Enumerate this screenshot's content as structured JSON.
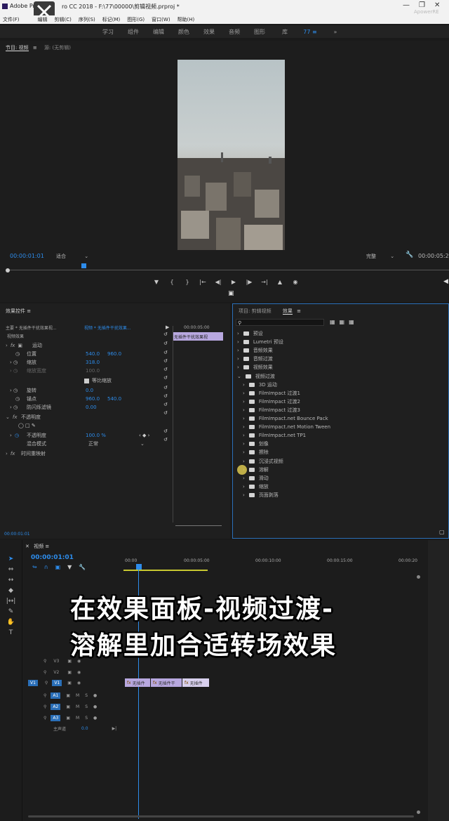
{
  "window": {
    "title": "Adobe Premiere Pro CC 2018 - F:\\77\\00000\\剪辑视频.prproj *",
    "title_visible": "Adobe Pre",
    "title_rest": "ro CC 2018 - F:\\77\\00000\\剪辑视频.prproj *",
    "watermark": "ApowerRE"
  },
  "menu": [
    "文件(F)",
    "编辑",
    "剪辑(C)",
    "序列(S)",
    "标记(M)",
    "图形(G)",
    "窗口(W)",
    "帮助(H)"
  ],
  "workspaces": [
    "学习",
    "组件",
    "编辑",
    "颜色",
    "效果",
    "音频",
    "图形",
    "库",
    "»"
  ],
  "workspace_active_index": 7,
  "program_monitor": {
    "tab1": "节目: 视频",
    "tab2": "源: (无剪辑)",
    "timecode": "00:00:01:01",
    "fit": "适合",
    "quality": "完整",
    "duration": "00:00:05:2"
  },
  "effect_controls": {
    "tab": "效果控件",
    "master": "主要 * 无插件干扰效果视...",
    "seq": "视频 * 无插件干扰效果...",
    "section": "视频效果",
    "timecode_top": "00:00:05:00",
    "clip_label": "无插件干扰效果视",
    "motion": "运动",
    "position": {
      "label": "位置",
      "x": "540.0",
      "y": "960.0"
    },
    "scale": {
      "label": "缩放",
      "value": "318.0"
    },
    "scale_width": {
      "label": "缩放宽度",
      "value": "100.0"
    },
    "uniform": "等比缩放",
    "rotation": {
      "label": "旋转",
      "value": "0.0"
    },
    "anchor": {
      "label": "锚点",
      "x": "960.0",
      "y": "540.0"
    },
    "flicker": {
      "label": "防闪烁滤镜",
      "value": "0.00"
    },
    "opacity_section": "不透明度",
    "opacity": {
      "label": "不透明度",
      "value": "100.0 %"
    },
    "blend": {
      "label": "混合模式",
      "value": "正常"
    },
    "remap": "时间重映射",
    "timecode_bottom": "00:00:01:01"
  },
  "effects": {
    "tab_project": "项目: 剪辑视频",
    "tab_effects": "效果",
    "items": [
      {
        "label": "预设",
        "level": 0
      },
      {
        "label": "Lumetri 预设",
        "level": 0
      },
      {
        "label": "音频效果",
        "level": 0
      },
      {
        "label": "音频过渡",
        "level": 0
      },
      {
        "label": "视频效果",
        "level": 0
      },
      {
        "label": "视频过渡",
        "level": 0,
        "open": true
      },
      {
        "label": "3D 运动",
        "level": 1
      },
      {
        "label": "FilmImpact 过渡1",
        "level": 1
      },
      {
        "label": "FilmImpact 过渡2",
        "level": 1
      },
      {
        "label": "FilmImpact 过渡3",
        "level": 1
      },
      {
        "label": "FilmImpact.net Bounce Pack",
        "level": 1
      },
      {
        "label": "FilmImpact.net Motion Tween",
        "level": 1
      },
      {
        "label": "FilmImpact.net TP1",
        "level": 1
      },
      {
        "label": "划像",
        "level": 1
      },
      {
        "label": "擦除",
        "level": 1
      },
      {
        "label": "沉浸式视频",
        "level": 1
      },
      {
        "label": "溶解",
        "level": 1
      },
      {
        "label": "滑动",
        "level": 1
      },
      {
        "label": "缩放",
        "level": 1
      },
      {
        "label": "页面剥落",
        "level": 1
      }
    ]
  },
  "timeline": {
    "tab": "视频",
    "timecode": "00:00:01:01",
    "ruler": [
      "00:00",
      "00:00:05:00",
      "00:00:10:00",
      "00:00:15:00",
      "00:00:20"
    ],
    "tracks": [
      "V3",
      "V2",
      "V1",
      "A1",
      "A2",
      "A3"
    ],
    "master": "主声道",
    "master_value": "0.0",
    "clips": [
      "无插件",
      "无插件干",
      "无插件"
    ]
  },
  "overlay_caption": [
    "在效果面板-视频过渡-",
    "溶解里加合适转场效果"
  ]
}
